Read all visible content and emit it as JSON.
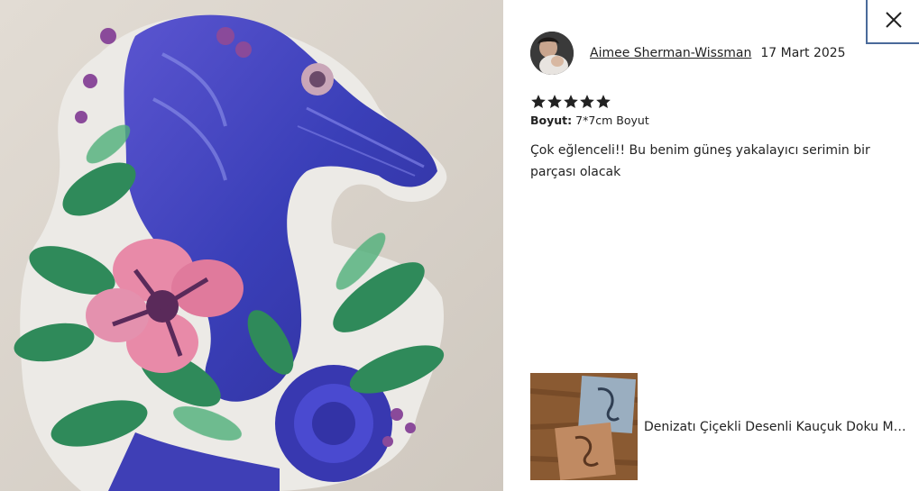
{
  "review": {
    "reviewer_name": "Aimee Sherman-Wissman",
    "date": "17 Mart 2025",
    "rating": 5,
    "variation_label": "Boyut:",
    "variation_value": "7*7cm Boyut",
    "text": "Çok eğlenceli!! Bu benim güneş yakalayıcı serimin bir parçası olacak"
  },
  "product": {
    "title": "Denizatı Çiçekli Desenli Kauçuk Doku Mat ..."
  },
  "icons": {
    "close": "close-icon",
    "star": "star-icon"
  },
  "colors": {
    "close_border": "#4a6a9a",
    "text": "#222222",
    "star": "#222222"
  }
}
